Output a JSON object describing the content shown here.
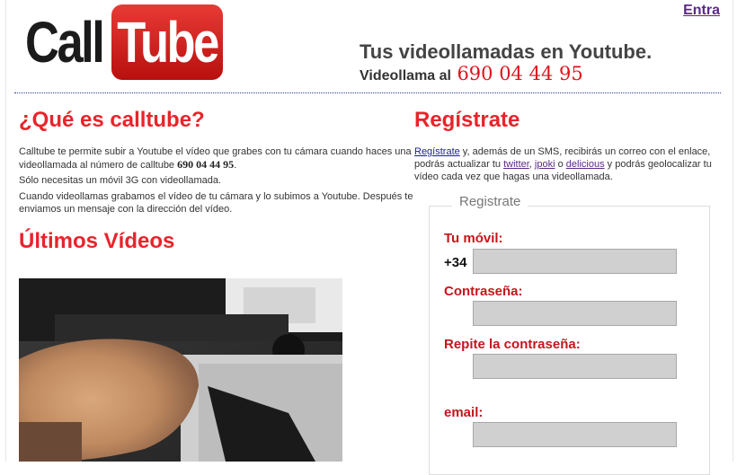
{
  "header": {
    "logo_part1": "Call",
    "logo_part2": "Tube",
    "login_link": "Entra",
    "tagline": "Tus videollamadas en Youtube.",
    "call_prefix": "Videollama al",
    "phone_number": "690 04 44 95"
  },
  "about": {
    "title": "¿Qué es calltube?",
    "p1_text": "Calltube te permite subir a Youtube el vídeo que grabes con tu cámara cuando haces una videollamada al número de calltube",
    "p1_number": "690 04 44 95",
    "p1_end": ".",
    "p2": "Sólo necesitas un móvil 3G con videollamada.",
    "p3": "Cuando videollamas grabamos el vídeo de tu cámara y lo subimos a Youtube. Después te enviamos un mensaje con la dirección del vídeo."
  },
  "videos": {
    "title": "Últimos Vídeos"
  },
  "register": {
    "title": "Regístrate",
    "text_link": "Regístrate",
    "text_1": " y, además de un SMS, recibirás un correo con el enlace, podrás actualizar tu ",
    "link_twitter": "twitter",
    "sep_1": ", ",
    "link_jpoki": "jpoki",
    "sep_2": " o ",
    "link_delicious": "delicious",
    "text_2": " y podrás geolocalizar tu vídeo cada vez que hagas una videollamada.",
    "legend": "Registrate",
    "mobile_label": "Tu móvil:",
    "mobile_prefix": "+34",
    "password_label": "Contraseña:",
    "repeat_label": "Repite la contraseña:",
    "email_label": "email:"
  },
  "colors": {
    "brand_red": "#e8242b",
    "label_red": "#c4161c",
    "link_blue": "#1a1aa6",
    "visited_purple": "#5c2a86"
  }
}
